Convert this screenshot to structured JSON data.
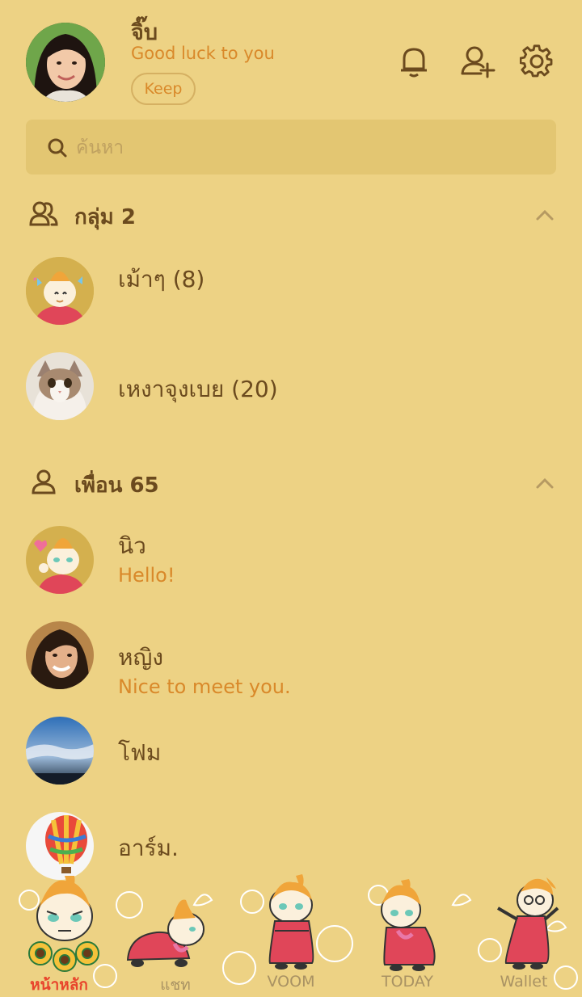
{
  "profile": {
    "name": "จิ๊บ",
    "status": "Good luck to you",
    "keep_label": "Keep"
  },
  "header_icons": [
    "bell-icon",
    "add-friend-icon",
    "gear-icon"
  ],
  "search": {
    "placeholder": "ค้นหา"
  },
  "groups": {
    "title": "กลุ่ม 2",
    "items": [
      {
        "name": "เม้าๆ (8)"
      },
      {
        "name": "เหงาจุงเบย (20)"
      }
    ]
  },
  "friends": {
    "title": "เพื่อน 65",
    "items": [
      {
        "name": "นิว",
        "message": "Hello!"
      },
      {
        "name": "หญิง",
        "message": "Nice to meet you."
      },
      {
        "name": "โฟม",
        "message": ""
      },
      {
        "name": "อาร์ม.",
        "message": ""
      }
    ]
  },
  "nav": {
    "items": [
      {
        "label": "หน้าหลัก",
        "active": true
      },
      {
        "label": "แชท",
        "active": false
      },
      {
        "label": "VOOM",
        "active": false
      },
      {
        "label": "TODAY",
        "active": false
      },
      {
        "label": "Wallet",
        "active": false
      }
    ]
  },
  "colors": {
    "background": "#EDD284",
    "search_bg": "#E3C672",
    "text_brown": "#6B4A1E",
    "accent_orange": "#D9892A",
    "active_tab": "#E8452C"
  }
}
